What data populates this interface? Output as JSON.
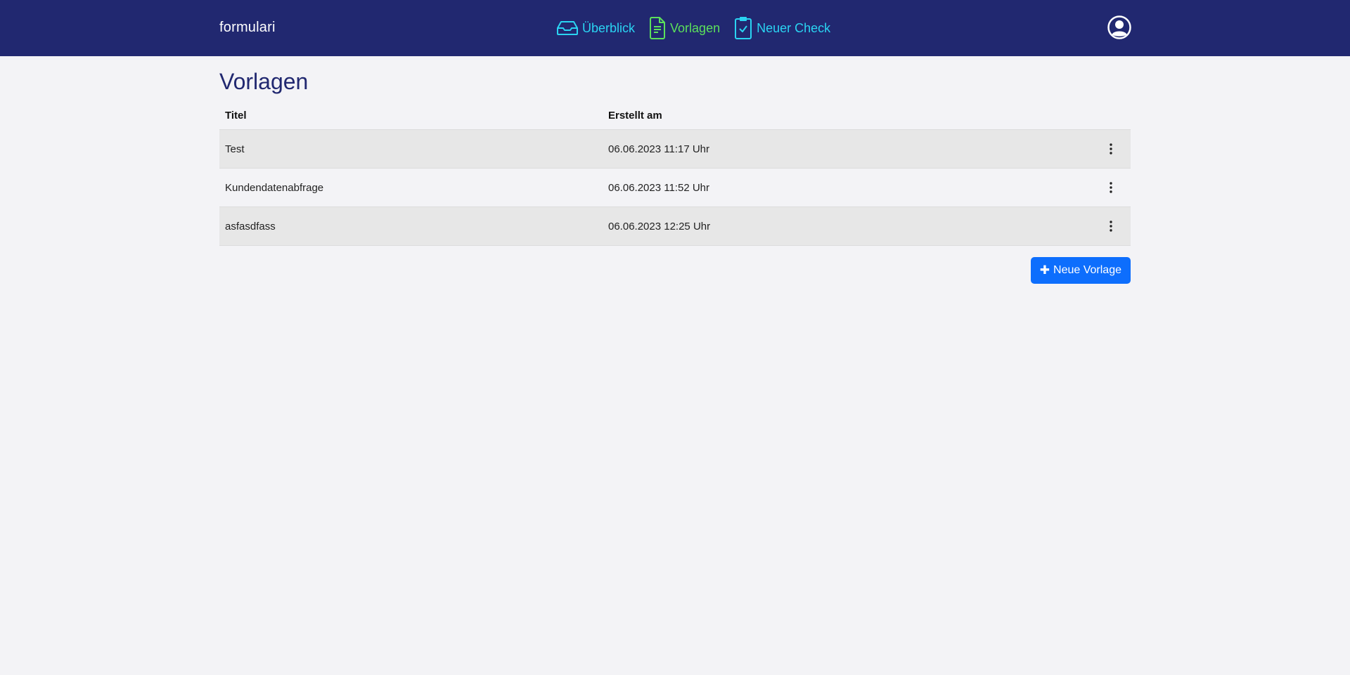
{
  "header": {
    "brand": "formulari",
    "nav": [
      {
        "label": "Überblick",
        "icon": "inbox-icon",
        "color": "#2ad4f2"
      },
      {
        "label": "Vorlagen",
        "icon": "document-icon",
        "color": "#5be05b"
      },
      {
        "label": "Neuer Check",
        "icon": "clipboard-check-icon",
        "color": "#2ad4f2"
      }
    ],
    "user_icon": "user-circle-icon"
  },
  "main": {
    "title": "Vorlagen",
    "table": {
      "columns": [
        "Titel",
        "Erstellt am",
        ""
      ],
      "rows": [
        {
          "title": "Test",
          "created": "06.06.2023 11:17 Uhr"
        },
        {
          "title": "Kundendatenabfrage",
          "created": "06.06.2023 11:52 Uhr"
        },
        {
          "title": "asfasdfass",
          "created": "06.06.2023 12:25 Uhr"
        }
      ]
    },
    "new_button": {
      "icon": "plus-icon",
      "label": "Neue Vorlage"
    }
  },
  "colors": {
    "header_bg": "#212870",
    "accent_cyan": "#2ad4f2",
    "accent_green": "#5be05b",
    "primary_button": "#0d6efd",
    "title_color": "#212870"
  }
}
